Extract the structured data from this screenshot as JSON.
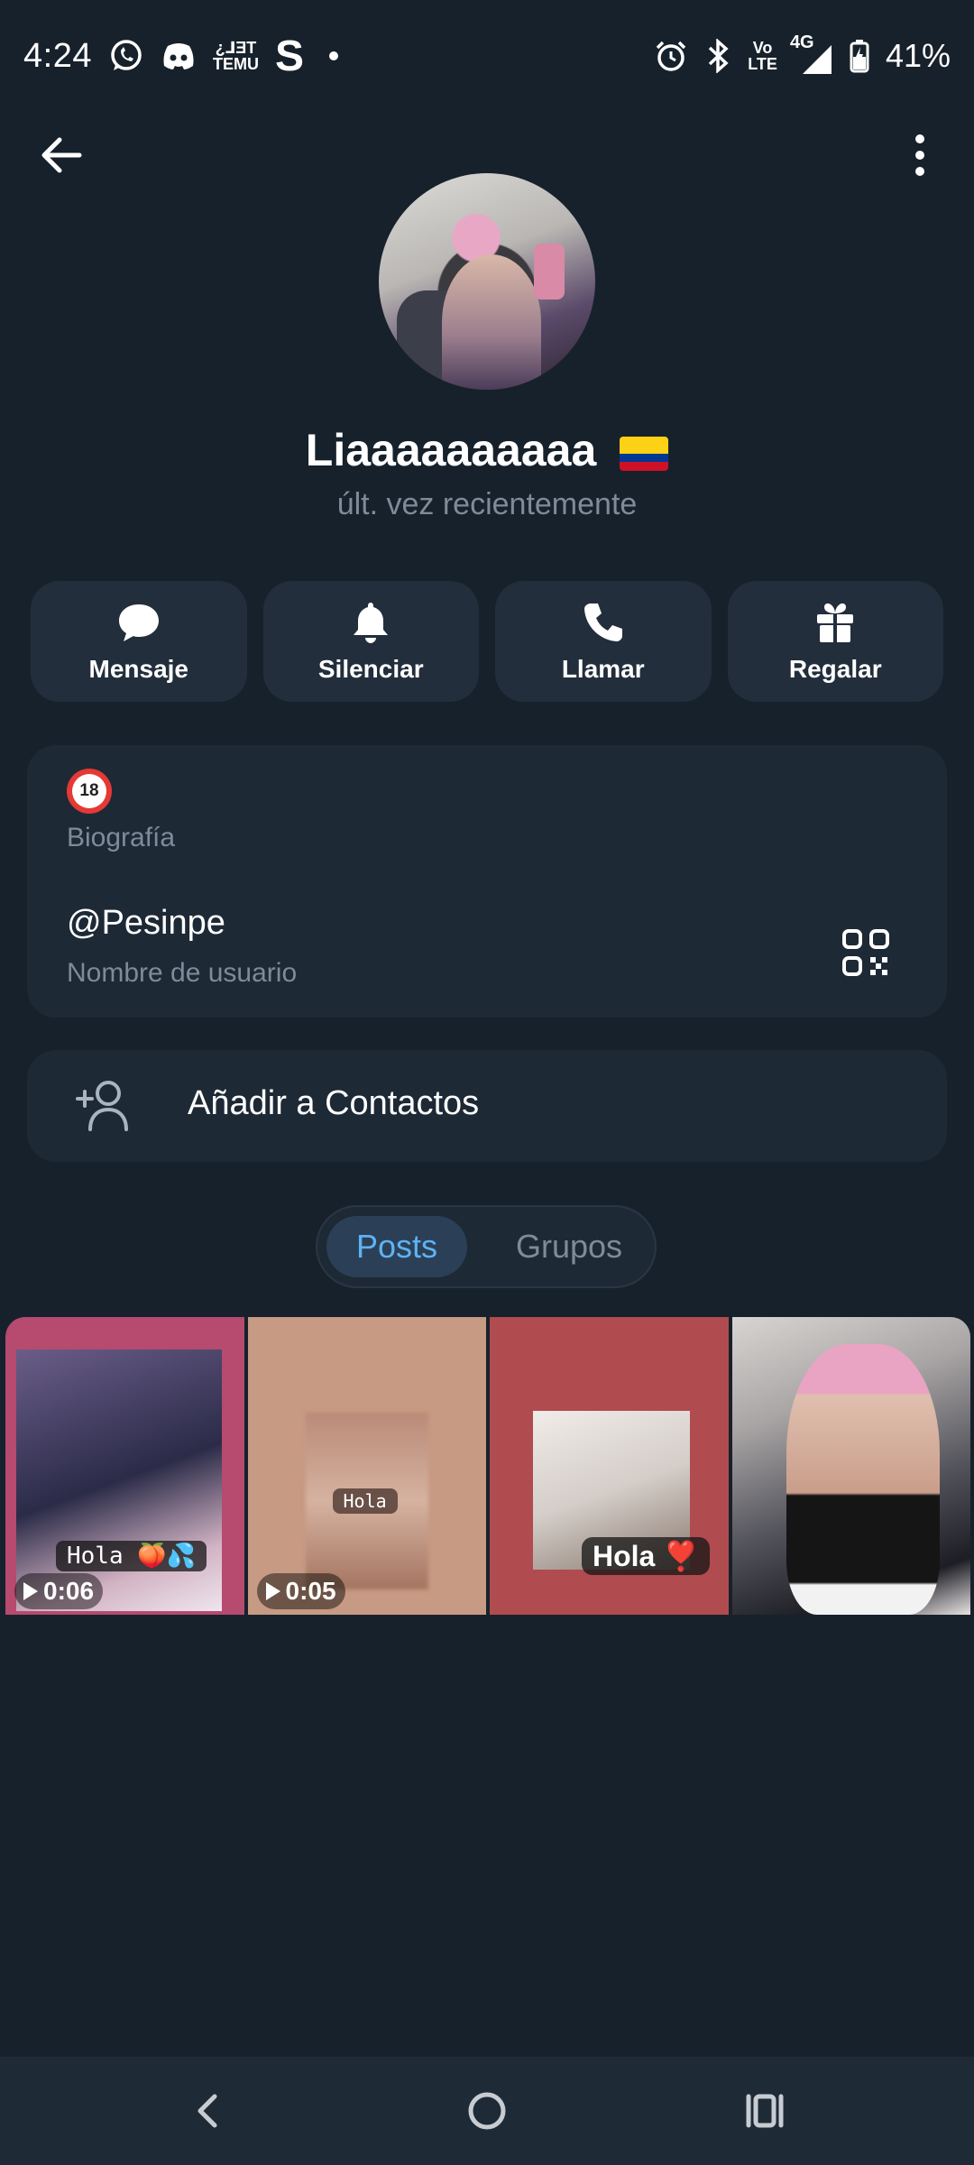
{
  "status_bar": {
    "time": "4:24",
    "temu_label_top": "¿⅃ƎT",
    "temu_label_bottom": "TEMU",
    "s_icon": "S",
    "network_vo": "Vo",
    "network_lte": "LTE",
    "network_type": "4G",
    "battery": "41%",
    "icons": [
      "whatsapp-icon",
      "discord-icon",
      "temu-icon",
      "s-icon",
      "notification-dot",
      "alarm-icon",
      "bluetooth-icon",
      "volte-icon",
      "signal-icon",
      "battery-charging-icon"
    ]
  },
  "header": {
    "back_icon": "arrow-left-icon",
    "menu_icon": "more-vertical-icon"
  },
  "profile": {
    "name": "Liaaaaaaaaaa",
    "flag": "colombia-flag",
    "status": "últ. vez recientemente"
  },
  "actions": [
    {
      "label": "Mensaje",
      "icon": "chat-bubble-icon"
    },
    {
      "label": "Silenciar",
      "icon": "bell-icon"
    },
    {
      "label": "Llamar",
      "icon": "phone-icon"
    },
    {
      "label": "Regalar",
      "icon": "gift-icon"
    }
  ],
  "info": {
    "bio_emoji": "no-under-18-emoji",
    "bio_label": "Biografía",
    "username": "@Pesinpe",
    "username_label": "Nombre de usuario",
    "qr_icon": "qr-code-icon"
  },
  "add_contact": {
    "label": "Añadir a Contactos",
    "icon": "add-person-icon"
  },
  "tabs": [
    {
      "label": "Posts",
      "active": true
    },
    {
      "label": "Grupos",
      "active": false
    }
  ],
  "posts": [
    {
      "caption": "Hola 🍑💦",
      "duration": "0:06"
    },
    {
      "caption": "Hola",
      "duration": "0:05"
    },
    {
      "caption": "Hola ❣️",
      "duration": ""
    },
    {
      "caption": "",
      "duration": ""
    }
  ],
  "colors": {
    "background": "#17212b",
    "card": "#232e3c",
    "secondary_text": "#7f8b98",
    "accent": "#5fb2f2"
  },
  "navbar": {
    "icons": [
      "nav-back-icon",
      "nav-home-icon",
      "nav-recents-icon"
    ]
  }
}
